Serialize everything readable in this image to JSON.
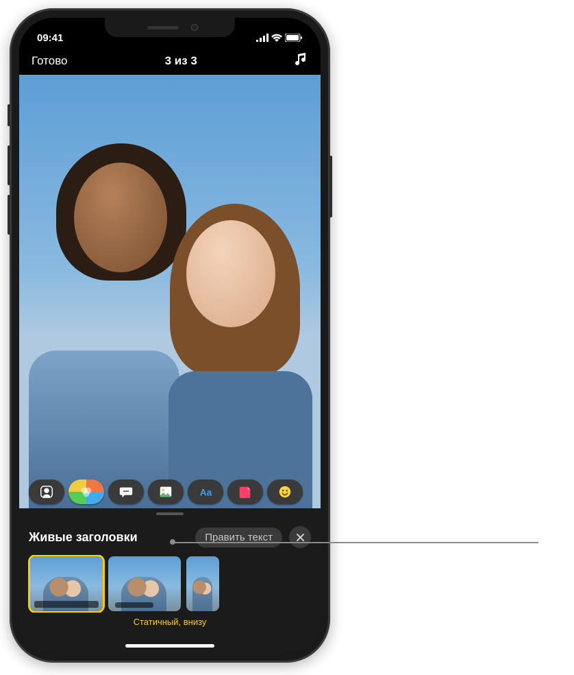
{
  "status": {
    "time": "09:41"
  },
  "nav": {
    "done": "Готово",
    "title": "3 из 3"
  },
  "tools": {
    "memoji": "memoji-icon",
    "filters": "filters-icon",
    "bubble": "speech-bubble-icon",
    "poster": "poster-icon",
    "text": "text-icon",
    "sticker": "sticker-icon",
    "emoji": "emoji-icon"
  },
  "panel": {
    "title": "Живые заголовки",
    "edit_label": "Править текст",
    "styles": [
      {
        "name": "none"
      },
      {
        "name": "static_bottom",
        "selected": true,
        "label": "Статичный, внизу"
      },
      {
        "name": "style_3"
      },
      {
        "name": "style_4"
      }
    ],
    "selected_label": "Статичный, внизу"
  }
}
